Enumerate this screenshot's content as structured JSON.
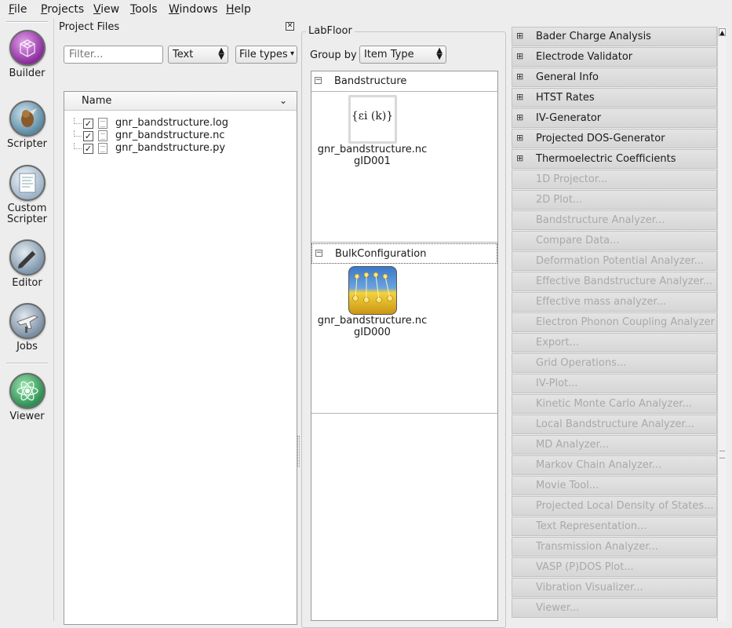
{
  "menu": {
    "items": [
      {
        "label": "File",
        "u": "F",
        "rest": "ile"
      },
      {
        "label": "Projects",
        "u": "P",
        "rest": "rojects"
      },
      {
        "label": "View",
        "u": "V",
        "rest": "iew"
      },
      {
        "label": "Tools",
        "u": "T",
        "rest": "ools"
      },
      {
        "label": "Windows",
        "u": "W",
        "rest": "indows"
      },
      {
        "label": "Help",
        "u": "H",
        "rest": "elp"
      }
    ]
  },
  "tools": {
    "builder": "Builder",
    "scripter": "Scripter",
    "custom_scripter_1": "Custom",
    "custom_scripter_2": "Scripter",
    "editor": "Editor",
    "jobs": "Jobs",
    "viewer": "Viewer"
  },
  "project_files": {
    "title": "Project Files",
    "filter_placeholder": "Filter...",
    "type_combo": "Text",
    "file_types": "File types",
    "column_name": "Name",
    "files": [
      {
        "name": "gnr_bandstructure.log",
        "checked": true
      },
      {
        "name": "gnr_bandstructure.nc",
        "checked": true
      },
      {
        "name": "gnr_bandstructure.py",
        "checked": true
      }
    ]
  },
  "labfloor": {
    "title": "LabFloor",
    "group_by_label": "Group by",
    "group_by_value": "Item Type",
    "groups": [
      {
        "name": "Bandstructure",
        "item_name": "gnr_bandstructure.nc",
        "item_id": "gID001",
        "formula": "{εi (k)}"
      },
      {
        "name": "BulkConfiguration",
        "item_name": "gnr_bandstructure.nc",
        "item_id": "gID000"
      }
    ]
  },
  "plugins": {
    "enabled": [
      "Bader Charge Analysis",
      "Electrode Validator",
      "General Info",
      "HTST Rates",
      "IV-Generator",
      "Projected DOS-Generator",
      "Thermoelectric Coefficients"
    ],
    "disabled": [
      "1D Projector...",
      "2D Plot...",
      "Bandstructure Analyzer...",
      "Compare Data...",
      "Deformation Potential Analyzer...",
      "Effective Bandstructure Analyzer...",
      "Effective mass analyzer...",
      "Electron Phonon Coupling Analyzer...",
      "Export...",
      "Grid Operations...",
      "IV-Plot...",
      "Kinetic Monte Carlo Analyzer...",
      "Local Bandstructure Analyzer...",
      "MD Analyzer...",
      "Markov Chain Analyzer...",
      "Movie Tool...",
      "Projected Local Density of States...",
      "Text Representation...",
      "Transmission Analyzer...",
      "VASP (P)DOS Plot...",
      "Vibration Visualizer...",
      "Viewer..."
    ]
  }
}
